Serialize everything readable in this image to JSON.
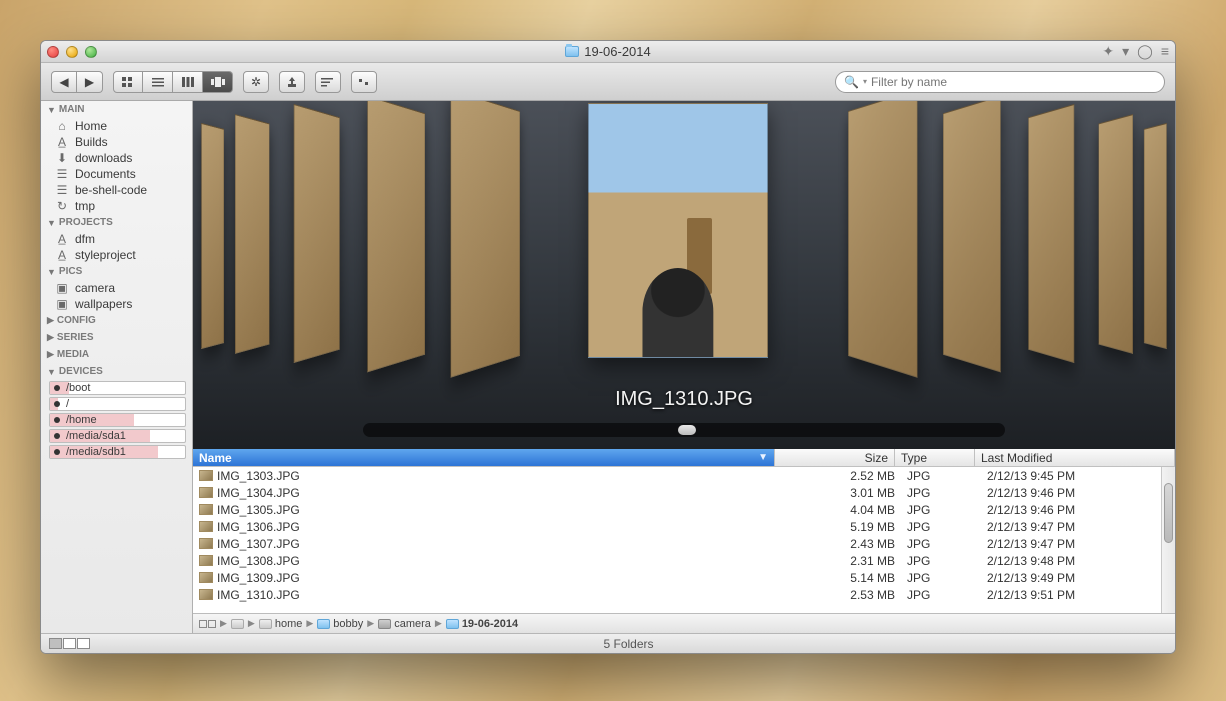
{
  "window": {
    "title": "19-06-2014"
  },
  "search": {
    "placeholder": "Filter by name"
  },
  "sidebar": {
    "sections": [
      {
        "label": "MAIN",
        "expanded": true,
        "items": [
          {
            "icon": "home-icon",
            "glyph": "⌂",
            "label": "Home"
          },
          {
            "icon": "builds-icon",
            "glyph": "A̲",
            "label": "Builds"
          },
          {
            "icon": "downloads-icon",
            "glyph": "⬇",
            "label": "downloads"
          },
          {
            "icon": "documents-icon",
            "glyph": "☰",
            "label": "Documents"
          },
          {
            "icon": "code-icon",
            "glyph": "☰",
            "label": "be-shell-code"
          },
          {
            "icon": "tmp-icon",
            "glyph": "↻",
            "label": "tmp"
          }
        ]
      },
      {
        "label": "PROJECTS",
        "expanded": true,
        "items": [
          {
            "icon": "project-icon",
            "glyph": "A̲",
            "label": "dfm"
          },
          {
            "icon": "project-icon",
            "glyph": "A̲",
            "label": "styleproject"
          }
        ]
      },
      {
        "label": "PICS",
        "expanded": true,
        "items": [
          {
            "icon": "camera-icon",
            "glyph": "▣",
            "label": "camera"
          },
          {
            "icon": "wallpapers-icon",
            "glyph": "▣",
            "label": "wallpapers"
          }
        ]
      },
      {
        "label": "CONFIG",
        "expanded": false,
        "items": []
      },
      {
        "label": "SERIES",
        "expanded": false,
        "items": []
      },
      {
        "label": "MEDIA",
        "expanded": false,
        "items": []
      },
      {
        "label": "DEVICES",
        "expanded": true,
        "devices": [
          {
            "label": "/boot",
            "fill": 14
          },
          {
            "label": "/",
            "fill": 6
          },
          {
            "label": "/home",
            "fill": 62
          },
          {
            "label": "/media/sda1",
            "fill": 74
          },
          {
            "label": "/media/sdb1",
            "fill": 80
          }
        ]
      }
    ]
  },
  "coverflow": {
    "current_label": "IMG_1310.JPG"
  },
  "columns": {
    "name": "Name",
    "size": "Size",
    "type": "Type",
    "modified": "Last Modified"
  },
  "files": [
    {
      "name": "IMG_1303.JPG",
      "size": "2.52 MB",
      "type": "JPG",
      "modified": "2/12/13 9:45 PM"
    },
    {
      "name": "IMG_1304.JPG",
      "size": "3.01 MB",
      "type": "JPG",
      "modified": "2/12/13 9:46 PM"
    },
    {
      "name": "IMG_1305.JPG",
      "size": "4.04 MB",
      "type": "JPG",
      "modified": "2/12/13 9:46 PM"
    },
    {
      "name": "IMG_1306.JPG",
      "size": "5.19 MB",
      "type": "JPG",
      "modified": "2/12/13 9:47 PM"
    },
    {
      "name": "IMG_1307.JPG",
      "size": "2.43 MB",
      "type": "JPG",
      "modified": "2/12/13 9:47 PM"
    },
    {
      "name": "IMG_1308.JPG",
      "size": "2.31 MB",
      "type": "JPG",
      "modified": "2/12/13 9:48 PM"
    },
    {
      "name": "IMG_1309.JPG",
      "size": "5.14 MB",
      "type": "JPG",
      "modified": "2/12/13 9:49 PM"
    },
    {
      "name": "IMG_1310.JPG",
      "size": "2.53 MB",
      "type": "JPG",
      "modified": "2/12/13 9:51 PM"
    }
  ],
  "path": [
    {
      "icon": "drive-icon",
      "label": ""
    },
    {
      "icon": "drive-icon",
      "label": "home"
    },
    {
      "icon": "folder-icon",
      "label": "bobby"
    },
    {
      "icon": "camera-icon",
      "label": "camera"
    },
    {
      "icon": "folder-icon",
      "label": "19-06-2014"
    }
  ],
  "status": {
    "text": "5 Folders"
  }
}
